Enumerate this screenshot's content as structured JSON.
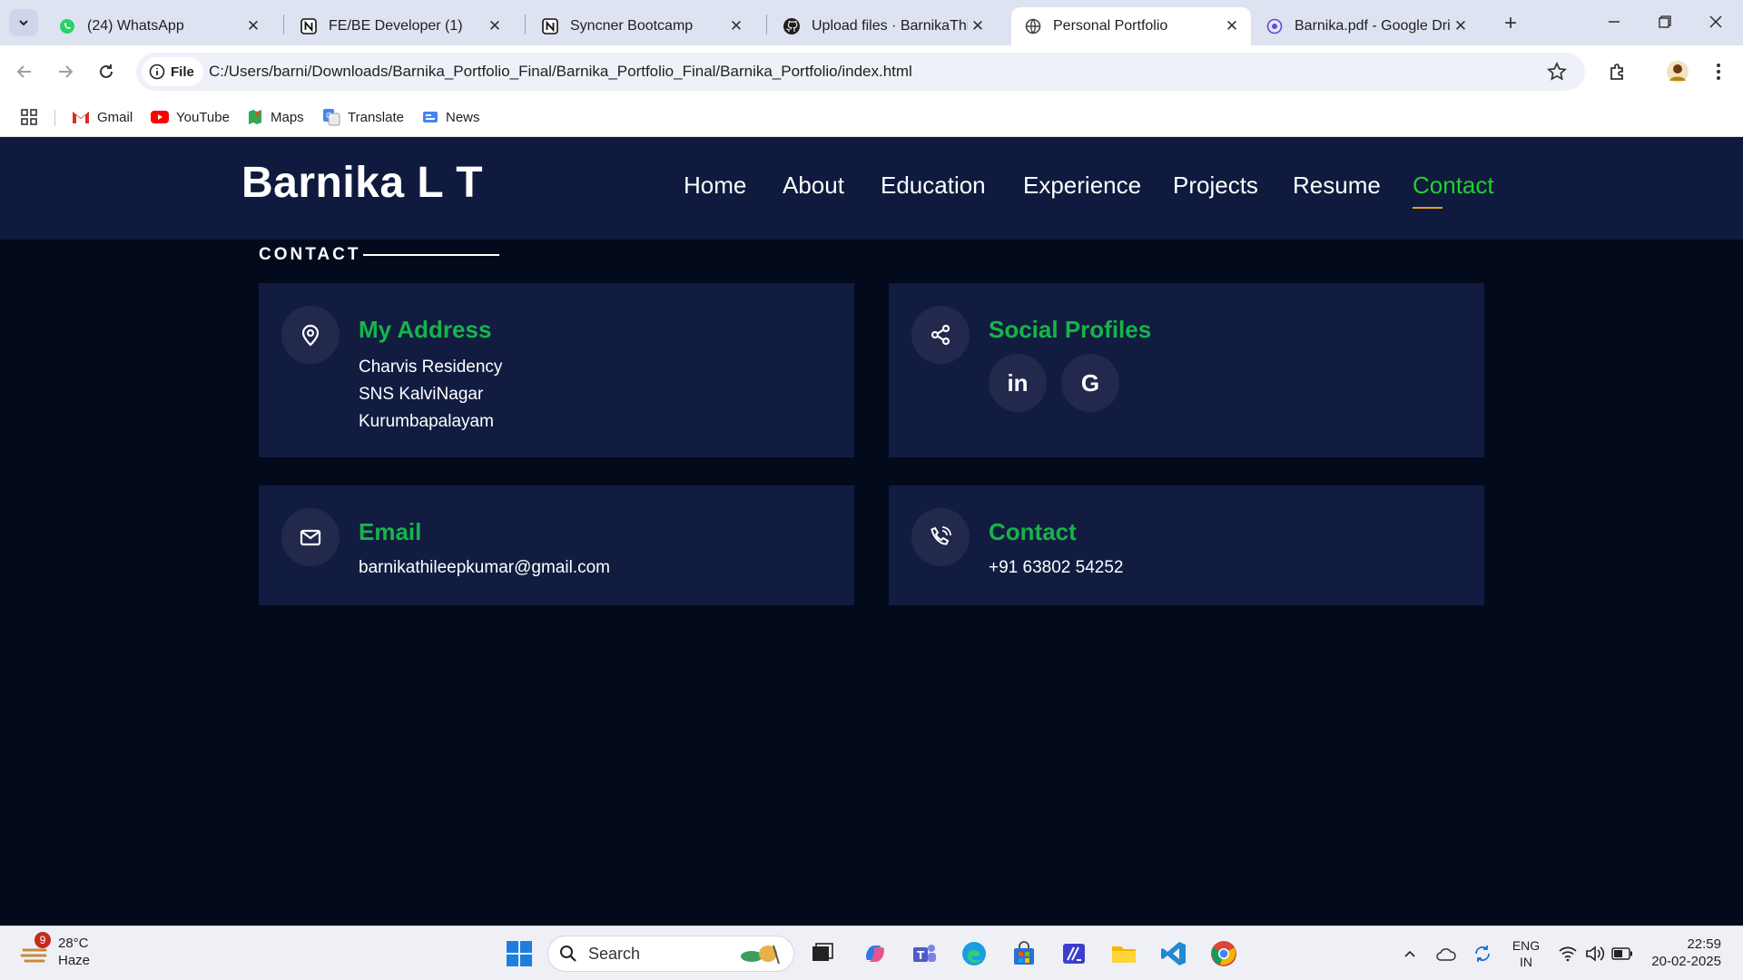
{
  "browser": {
    "tabs": [
      {
        "title": "(24) WhatsApp",
        "icon": "whatsapp-icon"
      },
      {
        "title": "FE/BE Developer (1)",
        "icon": "notion-icon"
      },
      {
        "title": "Syncner Bootcamp",
        "icon": "notion-icon"
      },
      {
        "title": "Upload files · BarnikaThileepKumar",
        "icon": "github-icon"
      },
      {
        "title": "Personal Portfolio",
        "icon": "globe-icon"
      },
      {
        "title": "Barnika.pdf - Google Drive",
        "icon": "drive-icon"
      }
    ],
    "active_tab": 4,
    "chip_label": "File",
    "url": "C:/Users/barni/Downloads/Barnika_Portfolio_Final/Barnika_Portfolio_Final/Barnika_Portfolio/index.html",
    "bookmarks": [
      "Gmail",
      "YouTube",
      "Maps",
      "Translate",
      "News"
    ]
  },
  "site": {
    "logo": "Barnika L T",
    "nav": [
      "Home",
      "About",
      "Education",
      "Experience",
      "Projects",
      "Resume",
      "Contact"
    ],
    "active_nav": "Contact",
    "section_label": "CONTACT",
    "address": {
      "title": "My Address",
      "lines": [
        "Charvis Residency",
        "SNS KalviNagar",
        "Kurumbapalayam"
      ]
    },
    "social": {
      "title": "Social Profiles",
      "links": [
        {
          "label": "in",
          "icon": "linkedin-icon"
        },
        {
          "label": "G",
          "icon": "google-icon"
        }
      ]
    },
    "email": {
      "title": "Email",
      "value": "barnikathileepkumar@gmail.com"
    },
    "contact": {
      "title": "Contact",
      "value": "+91 63802 54252"
    },
    "colors": {
      "header_bg": "#0f1a3e",
      "page_bg": "#030a1c",
      "card_bg": "#121c41",
      "accent_green": "#15b548",
      "nav_active": "#1fd12b"
    }
  },
  "taskbar": {
    "weather": {
      "temp": "28°C",
      "condition": "Haze",
      "badge": "9"
    },
    "search_placeholder": "Search",
    "lang": {
      "line1": "ENG",
      "line2": "IN"
    },
    "time": "22:59",
    "date": "20-02-2025"
  }
}
